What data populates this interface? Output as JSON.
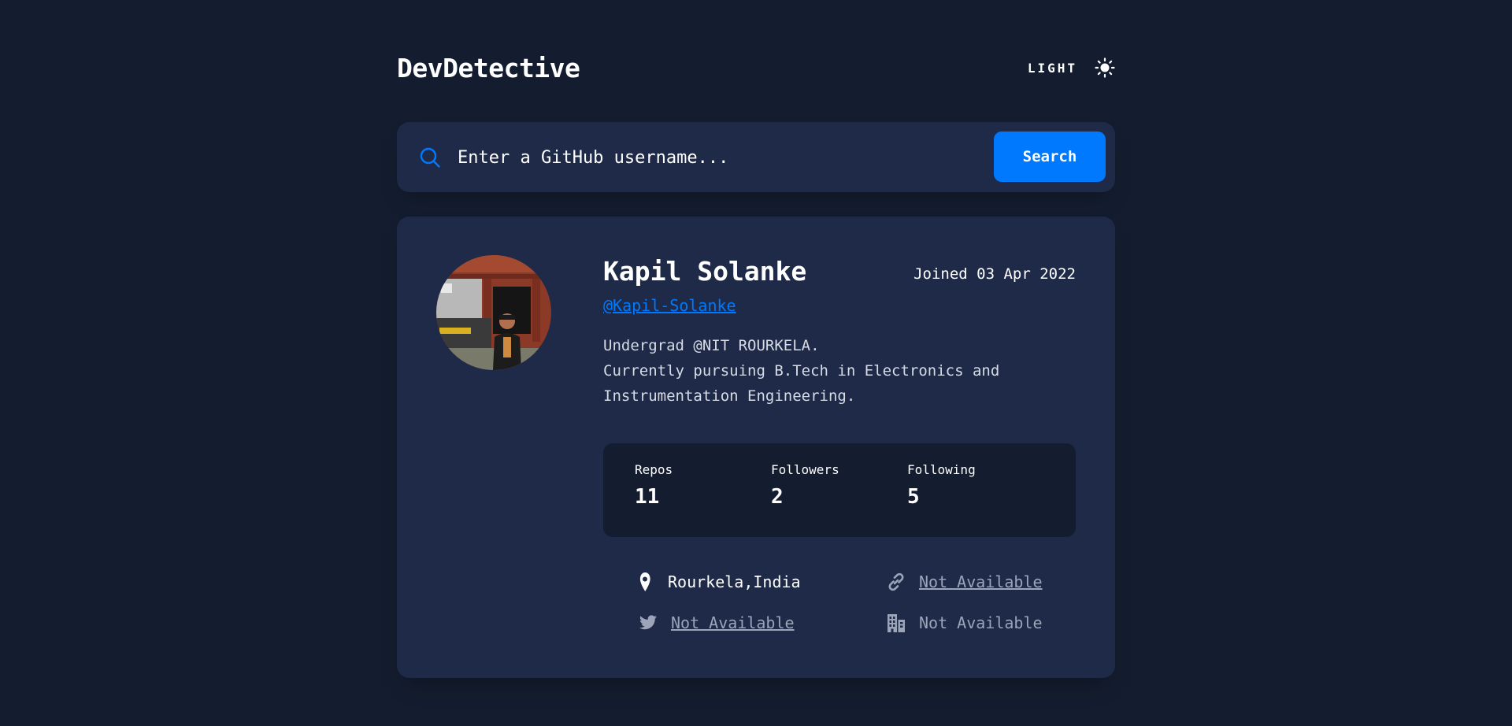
{
  "header": {
    "logo": "DevDetective",
    "theme_label": "LIGHT",
    "theme_icon": "sun-icon"
  },
  "search": {
    "placeholder": "Enter a GitHub username...",
    "button_label": "Search",
    "icon": "search-icon"
  },
  "profile": {
    "name": "Kapil Solanke",
    "joined": "Joined 03 Apr 2022",
    "username": "@Kapil-Solanke",
    "bio": "Undergrad @NIT ROURKELA.\nCurrently pursuing B.Tech in Electronics and\nInstrumentation Engineering."
  },
  "stats": {
    "repos_label": "Repos",
    "repos_value": "11",
    "followers_label": "Followers",
    "followers_value": "2",
    "following_label": "Following",
    "following_value": "5"
  },
  "links": {
    "location": "Rourkela,India",
    "website": "Not Available",
    "twitter": "Not Available",
    "company": "Not Available"
  },
  "colors": {
    "background": "#141d2f",
    "card": "#1e2a47",
    "accent": "#0079ff",
    "muted": "#9ba4b8"
  }
}
